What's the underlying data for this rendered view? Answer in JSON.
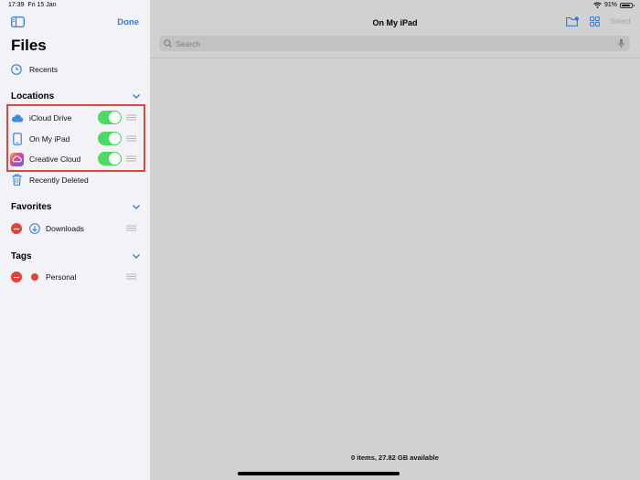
{
  "status_bar": {
    "time": "17:39",
    "date": "Fri 15 Jan",
    "battery": "91%"
  },
  "sidebar": {
    "done_label": "Done",
    "title": "Files",
    "recents_label": "Recents",
    "sections": {
      "locations": {
        "title": "Locations",
        "items": [
          {
            "label": "iCloud Drive",
            "icon": "icloud-icon",
            "enabled": true
          },
          {
            "label": "On My iPad",
            "icon": "ipad-icon",
            "enabled": true
          },
          {
            "label": "Creative Cloud",
            "icon": "creative-cloud-icon",
            "enabled": true
          }
        ],
        "recently_deleted": "Recently Deleted"
      },
      "favorites": {
        "title": "Favorites",
        "items": [
          {
            "label": "Downloads",
            "icon": "download-icon"
          }
        ]
      },
      "tags": {
        "title": "Tags",
        "items": [
          {
            "label": "Personal",
            "color": "#e0453a"
          }
        ]
      }
    }
  },
  "main": {
    "title": "On My iPad",
    "select_label": "Select",
    "search_placeholder": "Search",
    "footer": "0 items, 27.82 GB available"
  },
  "colors": {
    "accent": "#2f7bd6",
    "toggle_on": "#4cd964",
    "delete": "#e0453a",
    "highlight": "#d9483b"
  }
}
